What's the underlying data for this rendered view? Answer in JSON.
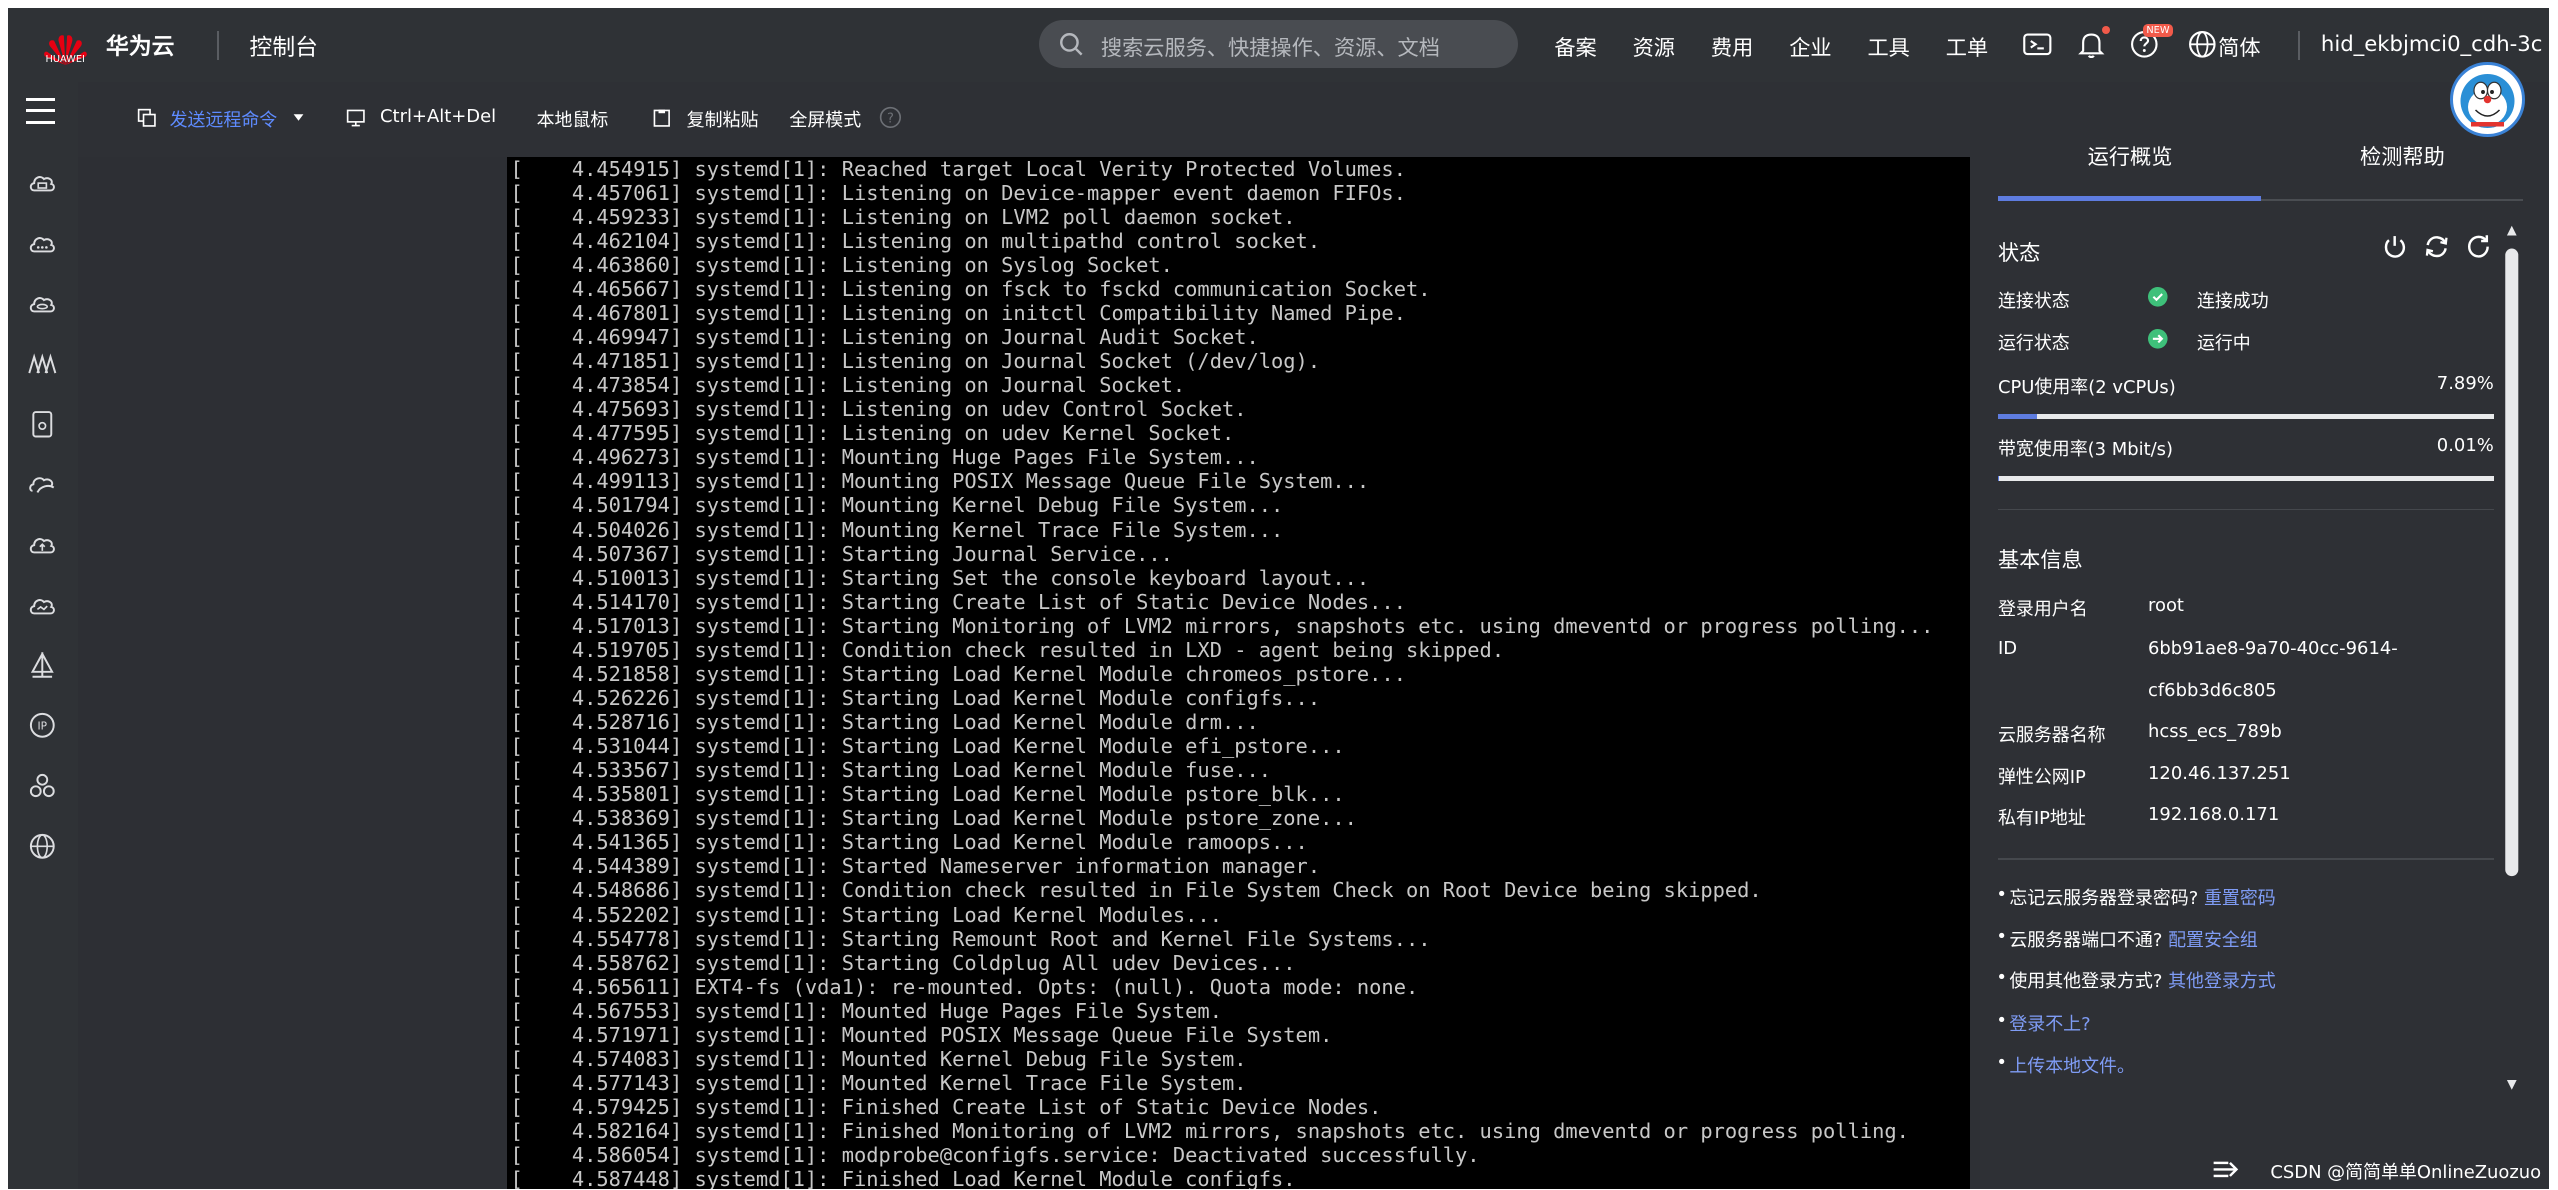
{
  "header": {
    "logo_text": "HUAWEI",
    "brand": "华为云",
    "console_label": "控制台",
    "search_placeholder": "搜索云服务、快捷操作、资源、文档",
    "nav": [
      "备案",
      "资源",
      "费用",
      "企业",
      "工具",
      "工单"
    ],
    "new_badge": "NEW",
    "language": "简体",
    "username": "hid_ekbjmci0_cdh-3c"
  },
  "sidebar": {
    "icons": [
      "cloud-server-icon",
      "cloud-icon",
      "cloud-database-icon",
      "network-icon",
      "storage-icon",
      "cdn-icon",
      "cloud-backup-icon",
      "cloud-monitor-icon",
      "deploy-icon",
      "ip-icon",
      "cluster-icon",
      "globe-icon"
    ]
  },
  "toolbar": {
    "send_command": "发送远程命令",
    "ctrl_alt_del": "Ctrl+Alt+Del",
    "local_cursor": "本地鼠标",
    "copy_paste": "复制粘贴",
    "fullscreen": "全屏模式"
  },
  "terminal": {
    "lines": [
      "[    4.454915] systemd[1]: Reached target Local Verity Protected Volumes.",
      "[    4.457061] systemd[1]: Listening on Device-mapper event daemon FIFOs.",
      "[    4.459233] systemd[1]: Listening on LVM2 poll daemon socket.",
      "[    4.462104] systemd[1]: Listening on multipathd control socket.",
      "[    4.463860] systemd[1]: Listening on Syslog Socket.",
      "[    4.465667] systemd[1]: Listening on fsck to fsckd communication Socket.",
      "[    4.467801] systemd[1]: Listening on initctl Compatibility Named Pipe.",
      "[    4.469947] systemd[1]: Listening on Journal Audit Socket.",
      "[    4.471851] systemd[1]: Listening on Journal Socket (/dev/log).",
      "[    4.473854] systemd[1]: Listening on Journal Socket.",
      "[    4.475693] systemd[1]: Listening on udev Control Socket.",
      "[    4.477595] systemd[1]: Listening on udev Kernel Socket.",
      "[    4.496273] systemd[1]: Mounting Huge Pages File System...",
      "[    4.499113] systemd[1]: Mounting POSIX Message Queue File System...",
      "[    4.501794] systemd[1]: Mounting Kernel Debug File System...",
      "[    4.504026] systemd[1]: Mounting Kernel Trace File System...",
      "[    4.507367] systemd[1]: Starting Journal Service...",
      "[    4.510013] systemd[1]: Starting Set the console keyboard layout...",
      "[    4.514170] systemd[1]: Starting Create List of Static Device Nodes...",
      "[    4.517013] systemd[1]: Starting Monitoring of LVM2 mirrors, snapshots etc. using dmeventd or progress polling...",
      "[    4.519705] systemd[1]: Condition check resulted in LXD - agent being skipped.",
      "[    4.521858] systemd[1]: Starting Load Kernel Module chromeos_pstore...",
      "[    4.526226] systemd[1]: Starting Load Kernel Module configfs...",
      "[    4.528716] systemd[1]: Starting Load Kernel Module drm...",
      "[    4.531044] systemd[1]: Starting Load Kernel Module efi_pstore...",
      "[    4.533567] systemd[1]: Starting Load Kernel Module fuse...",
      "[    4.535801] systemd[1]: Starting Load Kernel Module pstore_blk...",
      "[    4.538369] systemd[1]: Starting Load Kernel Module pstore_zone...",
      "[    4.541365] systemd[1]: Starting Load Kernel Module ramoops...",
      "[    4.544389] systemd[1]: Started Nameserver information manager.",
      "[    4.548686] systemd[1]: Condition check resulted in File System Check on Root Device being skipped.",
      "[    4.552202] systemd[1]: Starting Load Kernel Modules...",
      "[    4.554778] systemd[1]: Starting Remount Root and Kernel File Systems...",
      "[    4.558762] systemd[1]: Starting Coldplug All udev Devices...",
      "[    4.565611] EXT4-fs (vda1): re-mounted. Opts: (null). Quota mode: none.",
      "[    4.567553] systemd[1]: Mounted Huge Pages File System.",
      "[    4.571971] systemd[1]: Mounted POSIX Message Queue File System.",
      "[    4.574083] systemd[1]: Mounted Kernel Debug File System.",
      "[    4.577143] systemd[1]: Mounted Kernel Trace File System.",
      "[    4.579425] systemd[1]: Finished Create List of Static Device Nodes.",
      "[    4.582164] systemd[1]: Finished Monitoring of LVM2 mirrors, snapshots etc. using dmeventd or progress polling.",
      "[    4.586054] systemd[1]: modprobe@configfs.service: Deactivated successfully.",
      "[    4.587448] systemd[1]: Finished Load Kernel Module configfs."
    ]
  },
  "panel": {
    "tabs": [
      "运行概览",
      "检测帮助"
    ],
    "status_title": "状态",
    "conn_label": "连接状态",
    "conn_value": "连接成功",
    "run_label": "运行状态",
    "run_value": "运行中",
    "cpu_label": "CPU使用率(2 vCPUs)",
    "cpu_pct": "7.89%",
    "cpu_fraction": 0.0789,
    "bw_label": "带宽使用率(3 Mbit/s)",
    "bw_pct": "0.01%",
    "bw_fraction": 0.0001,
    "basic_title": "基本信息",
    "user_label": "登录用户名",
    "user_value": "root",
    "id_label": "ID",
    "id_value_1": "6bb91ae8-9a70-40cc-9614-",
    "id_value_2": "cf6bb3d6c805",
    "name_label": "云服务器名称",
    "name_value": "hcss_ecs_789b",
    "eip_label": "弹性公网IP",
    "eip_value": "120.46.137.251",
    "pip_label": "私有IP地址",
    "pip_value": "192.168.0.171",
    "help1_text": "忘记云服务器登录密码?",
    "help1_link": "重置密码",
    "help2_text": "云服务器端口不通?",
    "help2_link": "配置安全组",
    "help3_text": "使用其他登录方式?",
    "help3_link": "其他登录方式",
    "help4_link": "登录不上?",
    "help5_link": "上传本地文件。"
  },
  "footer": {
    "watermark": "CSDN @简简单单OnlineZuozuo"
  },
  "colors": {
    "accent": "#5e7ce0",
    "status_green": "#3ec07a",
    "link": "#7f9cf5"
  }
}
